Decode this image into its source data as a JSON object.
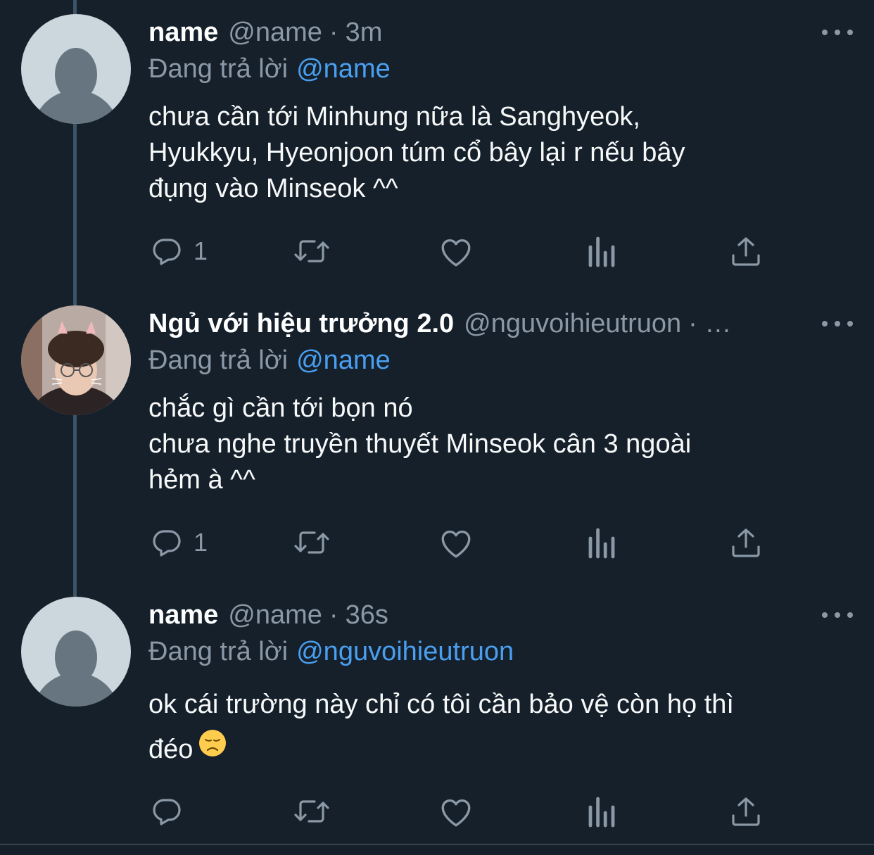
{
  "colors": {
    "background": "#15202b",
    "secondary_text": "#8b98a5",
    "link": "#4a9ff0",
    "thread_line": "#3d5466"
  },
  "tweets": [
    {
      "display_name": "name",
      "handle": "@name",
      "separator": "·",
      "time": "3m",
      "reply_prefix": "Đang trả lời",
      "reply_to": "@name",
      "lines": [
        "chưa cần tới Minhung nữa là Sanghyeok,",
        "Hyukkyu, Hyeonjoon túm cổ bây lại r nếu bây",
        "đụng vào Minseok ^^"
      ],
      "reply_count": "1",
      "avatar": "default-avatar-icon"
    },
    {
      "display_name": "Ngủ với hiệu trưởng 2.0",
      "handle": "@nguvoihieutruon",
      "separator": "· …",
      "time": "",
      "reply_prefix": "Đang trả lời",
      "reply_to": "@name",
      "lines": [
        "chắc gì cần tới bọn nó",
        "chưa nghe truyền thuyết Minseok cân 3 ngoài",
        "hẻm à ^^"
      ],
      "reply_count": "1",
      "avatar": "profile-photo"
    },
    {
      "display_name": "name",
      "handle": "@name",
      "separator": "·",
      "time": "36s",
      "reply_prefix": "Đang trả lời",
      "reply_to": "@nguvoihieutruon",
      "lines": [
        "ok cái trường này chỉ có tôi cần bảo vệ còn họ thì",
        "đéo"
      ],
      "reply_count": "",
      "avatar": "default-avatar-icon",
      "emoji": "disappointed-face-emoji"
    }
  ],
  "icons": {
    "reply": "reply-icon",
    "retweet": "retweet-icon",
    "like": "heart-icon",
    "analytics": "analytics-icon",
    "share": "share-icon",
    "more": "more-icon"
  }
}
